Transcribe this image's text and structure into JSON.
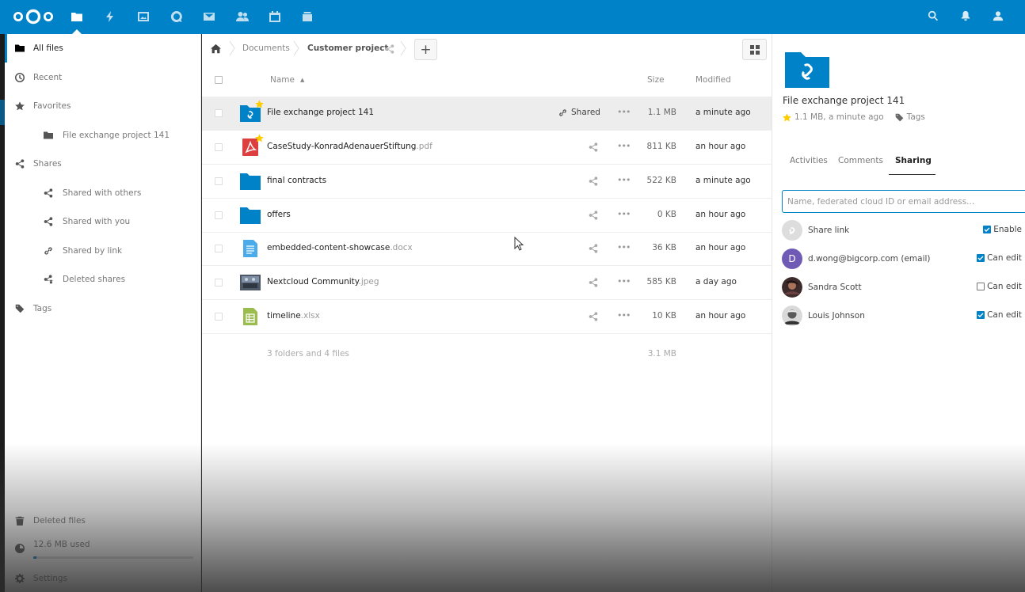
{
  "header": {
    "apps": [
      {
        "name": "files-app"
      },
      {
        "name": "activity-app"
      },
      {
        "name": "gallery-app"
      },
      {
        "name": "talk-app"
      },
      {
        "name": "mail-app"
      },
      {
        "name": "contacts-app"
      },
      {
        "name": "calendar-app"
      },
      {
        "name": "deck-app"
      }
    ],
    "accent": "#0082c9"
  },
  "nav": {
    "items": [
      {
        "label": "All files",
        "icon": "folder-icon"
      },
      {
        "label": "Recent",
        "icon": "clock-icon"
      },
      {
        "label": "Favorites",
        "icon": "star-icon"
      },
      {
        "label": "File exchange project 141",
        "icon": "folder-icon"
      },
      {
        "label": "Shares",
        "icon": "share-icon"
      },
      {
        "label": "Shared with others",
        "icon": "share-icon"
      },
      {
        "label": "Shared with you",
        "icon": "share-icon"
      },
      {
        "label": "Shared by link",
        "icon": "link-icon"
      },
      {
        "label": "Deleted shares",
        "icon": "deleted-share-icon"
      },
      {
        "label": "Tags",
        "icon": "tag-icon"
      }
    ],
    "deleted_files": "Deleted files",
    "quota": "12.6 MB used",
    "quota_fraction": 0.02,
    "settings": "Settings"
  },
  "breadcrumb": {
    "items": [
      "Documents",
      "Customer project"
    ]
  },
  "columns": {
    "name": "Name",
    "size": "Size",
    "modified": "Modified"
  },
  "files": [
    {
      "name": "File exchange project 141",
      "ext": "",
      "size": "1.1 MB",
      "modified": "a minute ago",
      "type": "folder-link",
      "favorite": true,
      "shared_label": "Shared"
    },
    {
      "name": "CaseStudy-KonradAdenauerStiftung",
      "ext": ".pdf",
      "size": "811 KB",
      "modified": "an hour ago",
      "type": "pdf",
      "favorite": true
    },
    {
      "name": "final contracts",
      "ext": "",
      "size": "522 KB",
      "modified": "a minute ago",
      "type": "folder"
    },
    {
      "name": "offers",
      "ext": "",
      "size": "0 KB",
      "modified": "an hour ago",
      "type": "folder"
    },
    {
      "name": "embedded-content-showcase",
      "ext": ".docx",
      "size": "36 KB",
      "modified": "an hour ago",
      "type": "doc"
    },
    {
      "name": "Nextcloud Community",
      "ext": ".jpeg",
      "size": "585 KB",
      "modified": "a day ago",
      "type": "image"
    },
    {
      "name": "timeline",
      "ext": ".xlsx",
      "size": "10 KB",
      "modified": "an hour ago",
      "type": "sheet"
    }
  ],
  "summary": {
    "count": "3 folders and 4 files",
    "size": "3.1 MB"
  },
  "sidebar": {
    "title": "File exchange project 141",
    "meta": "1.1 MB, a minute ago",
    "tags": "Tags",
    "tabs": [
      "Activities",
      "Comments",
      "Sharing"
    ],
    "share_placeholder": "Name, federated cloud ID or email address...",
    "share_link": {
      "label": "Share link",
      "perm": "Enable",
      "checked": true
    },
    "shares": [
      {
        "name": "d.wong@bigcorp.com (email)",
        "initial": "D",
        "perm": "Can edit",
        "checked": true,
        "avatar_color": "#6f5bb5"
      },
      {
        "name": "Sandra Scott",
        "perm": "Can edit",
        "checked": false
      },
      {
        "name": "Louis Johnson",
        "perm": "Can edit",
        "checked": true
      }
    ]
  }
}
